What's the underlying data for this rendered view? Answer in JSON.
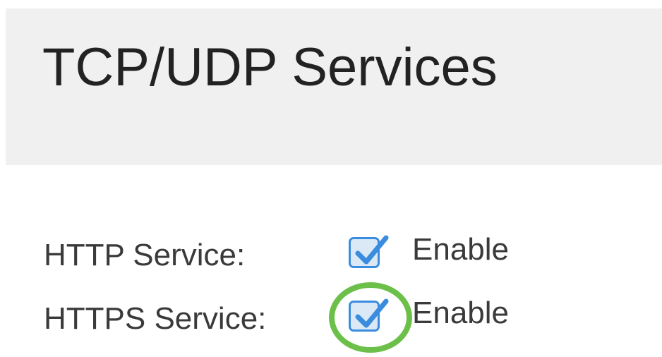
{
  "page": {
    "title": "TCP/UDP Services"
  },
  "services": {
    "http": {
      "label": "HTTP Service:",
      "enable_label": "Enable",
      "checked": true
    },
    "https": {
      "label": "HTTPS Service:",
      "enable_label": "Enable",
      "checked": true,
      "highlighted": true
    }
  },
  "colors": {
    "header_background": "#f0f0f0",
    "checkbox_border": "#3a8dde",
    "checkbox_fill": "#dbe9f6",
    "checkmark": "#3a8dde",
    "highlight_ring": "#6cc04a",
    "text": "#3a3a3a"
  },
  "icons": {
    "checkmark": "checkmark-icon"
  }
}
